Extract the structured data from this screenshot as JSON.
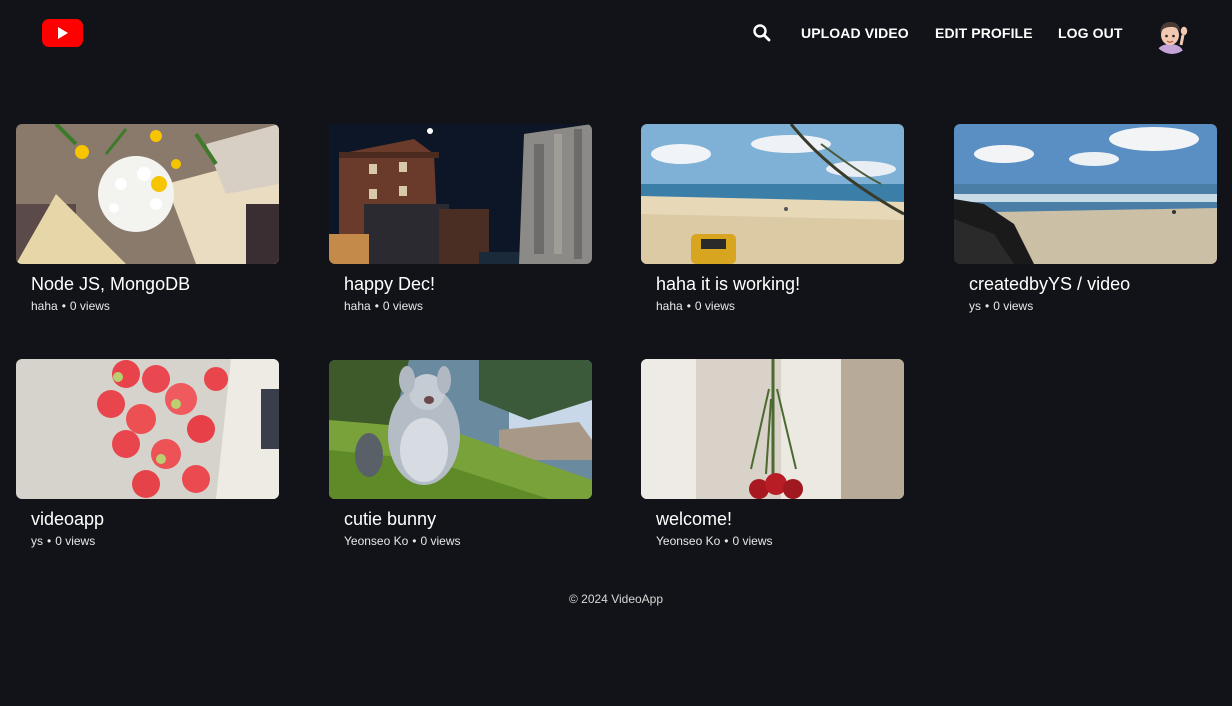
{
  "header": {
    "logo_icon": "youtube-play-icon",
    "search_icon": "search-icon",
    "nav": {
      "upload": "UPLOAD VIDEO",
      "edit_profile": "EDIT PROFILE",
      "logout": "LOG OUT"
    },
    "avatar_icon": "waving-person-avatar",
    "brand_color": "#ff0000"
  },
  "videos": [
    {
      "title": "Node JS, MongoDB",
      "author": "haha",
      "views": "0 views",
      "thumb_icon": "flower-bouquet-image"
    },
    {
      "title": "happy Dec!",
      "author": "haha",
      "views": "0 views",
      "thumb_icon": "night-buildings-image"
    },
    {
      "title": "haha it is working!",
      "author": "haha",
      "views": "0 views",
      "thumb_icon": "beach-image"
    },
    {
      "title": "createdbyYS / video",
      "author": "ys",
      "views": "0 views",
      "thumb_icon": "rocky-beach-image"
    },
    {
      "title": "videoapp",
      "author": "ys",
      "views": "0 views",
      "thumb_icon": "peonies-image"
    },
    {
      "title": "cutie bunny",
      "author": "Yeonseo Ko",
      "views": "0 views",
      "thumb_icon": "cartoon-bunny-image"
    },
    {
      "title": "welcome!",
      "author": "Yeonseo Ko",
      "views": "0 views",
      "thumb_icon": "hanging-roses-image"
    }
  ],
  "footer": {
    "text": "© 2024 VideoApp"
  }
}
